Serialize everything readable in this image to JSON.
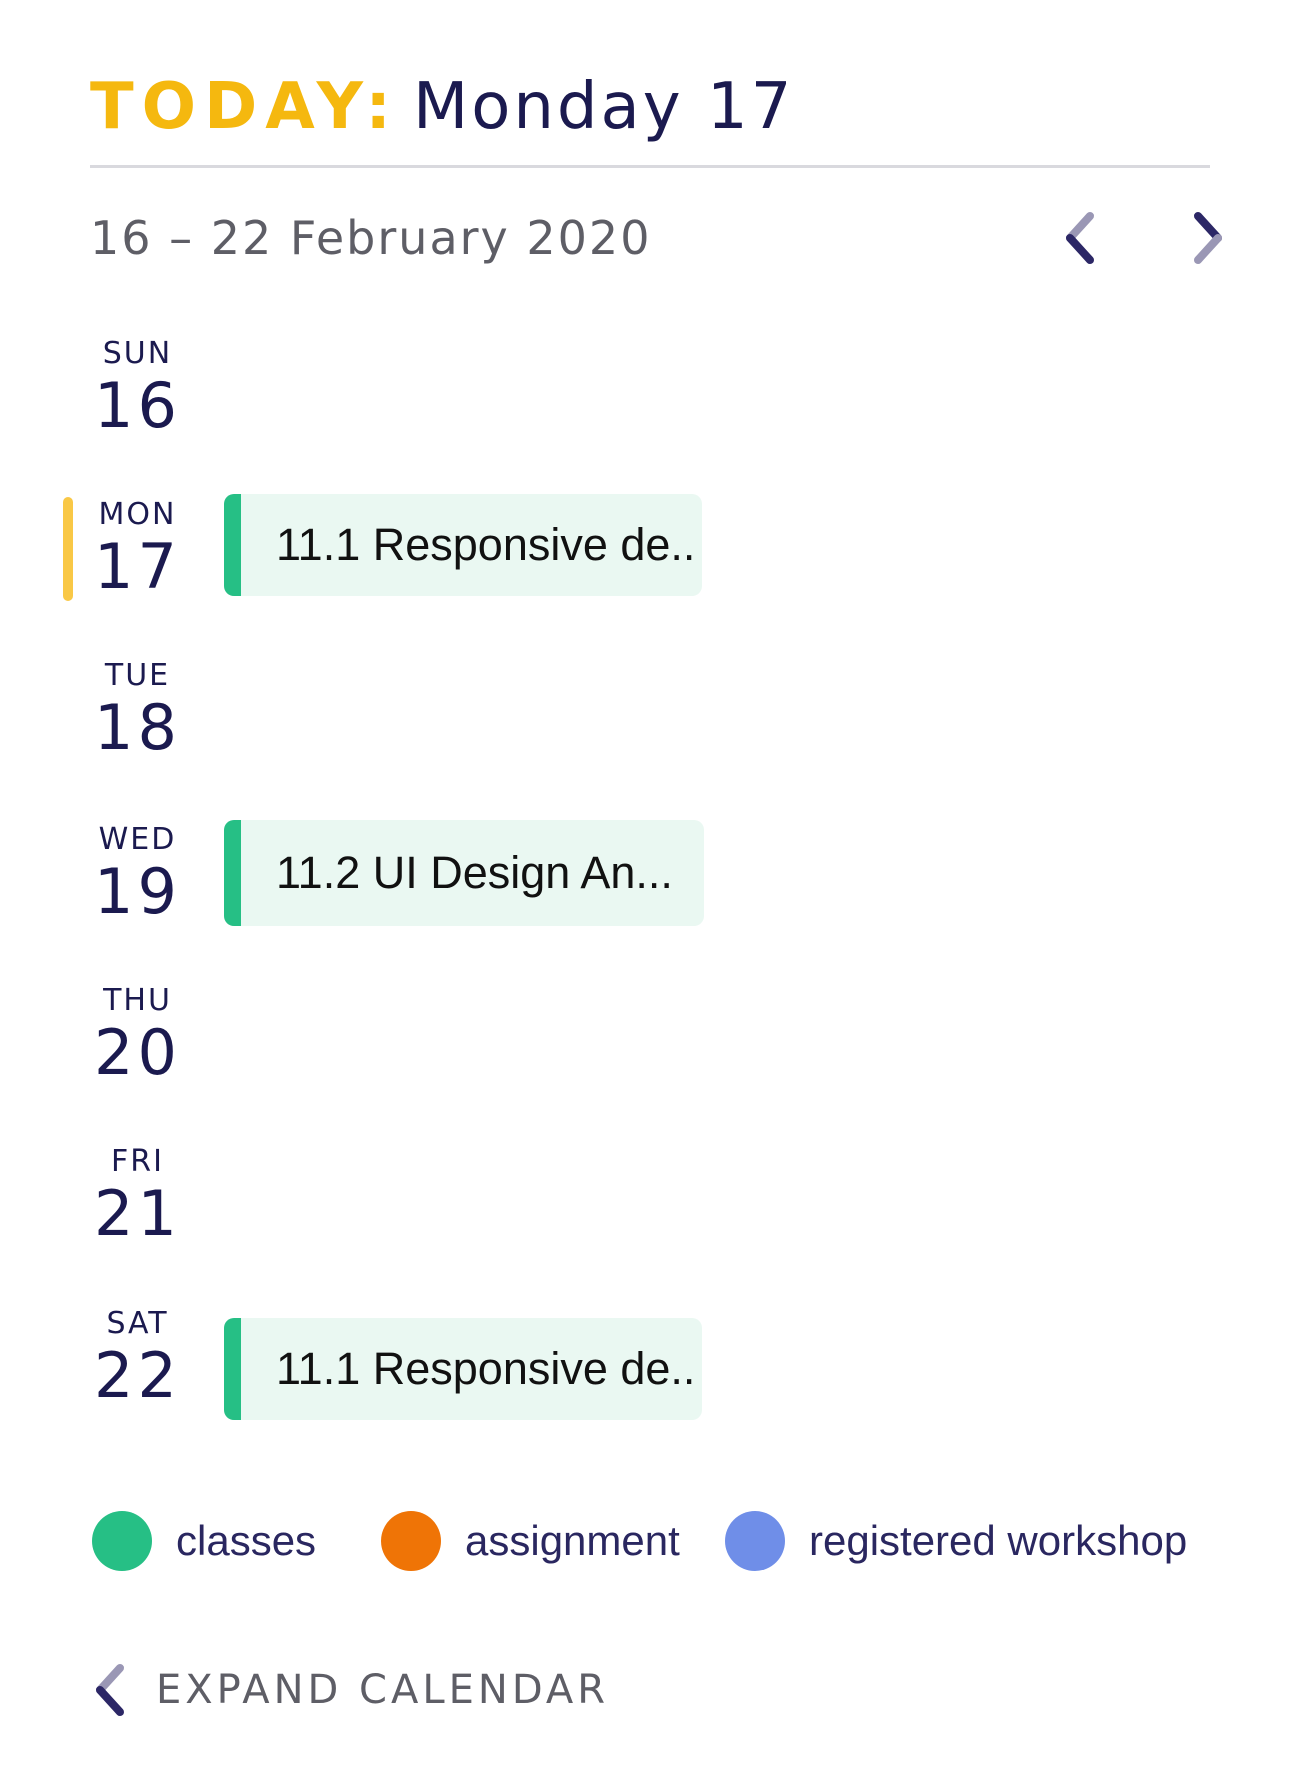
{
  "header": {
    "today_label": "TODAY:",
    "today_value": "Monday 17"
  },
  "week": {
    "range": "16 – 22 February 2020",
    "prev_icon": "chevron-left-icon",
    "next_icon": "chevron-right-icon"
  },
  "days": [
    {
      "label": "SUN",
      "num": "16",
      "today": false,
      "event": null
    },
    {
      "label": "MON",
      "num": "17",
      "today": true,
      "event": {
        "title": "11.1 Responsive de..",
        "type": "classes"
      }
    },
    {
      "label": "TUE",
      "num": "18",
      "today": false,
      "event": null
    },
    {
      "label": "WED",
      "num": "19",
      "today": false,
      "event": {
        "title": "11.2 UI Design An...",
        "type": "classes"
      }
    },
    {
      "label": "THU",
      "num": "20",
      "today": false,
      "event": null
    },
    {
      "label": "FRI",
      "num": "21",
      "today": false,
      "event": null
    },
    {
      "label": "SAT",
      "num": "22",
      "today": false,
      "event": {
        "title": "11.1 Responsive de..",
        "type": "classes"
      }
    }
  ],
  "legend": [
    {
      "label": "classes",
      "color": "#26bf85"
    },
    {
      "label": "assignment",
      "color": "#ef7406"
    },
    {
      "label": "registered workshop",
      "color": "#6f8ee8"
    }
  ],
  "footer": {
    "expand_label": "EXPAND CALENDAR",
    "expand_icon": "chevron-left-icon"
  },
  "colors": {
    "accent": "#f5b80f",
    "primary_text": "#1b1a4f",
    "today_indicator": "#f9c846",
    "event_bg": "#eaf8f2",
    "event_bar": "#26bf85"
  }
}
